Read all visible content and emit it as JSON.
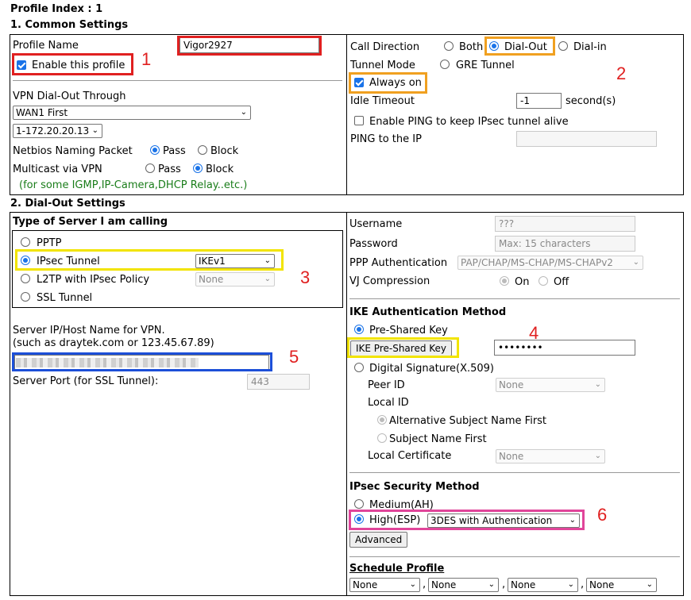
{
  "profile_index": "Profile Index : 1",
  "sections": {
    "common": "1. Common Settings",
    "dialout": "2. Dial-Out Settings"
  },
  "common": {
    "profile_name_label": "Profile Name",
    "profile_name_value": "Vigor2927",
    "enable_profile_label": "Enable this profile",
    "enable_profile_checked": true,
    "vpn_through_label": "VPN Dial-Out Through",
    "vpn_through_value": "WAN1 First",
    "ip_value": "1-172.20.20.13",
    "netbios_label": "Netbios Naming Packet",
    "netbios_pass": "Pass",
    "netbios_block": "Block",
    "multicast_label": "Multicast via VPN",
    "multicast_pass": "Pass",
    "multicast_block": "Block",
    "multicast_note": "(for some IGMP,IP-Camera,DHCP Relay..etc.)",
    "call_direction_label": "Call Direction",
    "call_both": "Both",
    "call_dialout": "Dial-Out",
    "call_dialin": "Dial-in",
    "tunnel_mode_label": "Tunnel Mode",
    "gre_tunnel": "GRE Tunnel",
    "always_on": "Always on",
    "idle_timeout_label": "Idle Timeout",
    "idle_timeout_value": "-1",
    "idle_unit": "second(s)",
    "enable_ping": "Enable PING to keep IPsec tunnel alive",
    "ping_ip_label": "PING to the IP"
  },
  "dialout": {
    "server_type_title": "Type of Server I am calling",
    "pptp": "PPTP",
    "ipsec": "IPsec Tunnel",
    "ike_version": "IKEv1",
    "l2tp": "L2TP with IPsec Policy",
    "l2tp_policy": "None",
    "ssl": "SSL Tunnel",
    "server_host_label": "Server IP/Host Name for VPN.",
    "server_host_hint": "(such as draytek.com or 123.45.67.89)",
    "server_port_label": "Server Port (for SSL Tunnel):",
    "server_port_value": "443",
    "username_label": "Username",
    "username_value": "???",
    "password_label": "Password",
    "password_placeholder": "Max: 15 characters",
    "ppp_auth_label": "PPP Authentication",
    "ppp_auth_value": "PAP/CHAP/MS-CHAP/MS-CHAPv2",
    "vj_label": "VJ Compression",
    "vj_on": "On",
    "vj_off": "Off",
    "ike_title": "IKE Authentication Method",
    "psk": "Pre-Shared Key",
    "psk_button": "IKE Pre-Shared Key",
    "psk_value": "••••••••",
    "digital_sig": "Digital Signature(X.509)",
    "peer_id_label": "Peer ID",
    "peer_id_value": "None",
    "local_id_label": "Local ID",
    "alt_subject": "Alternative Subject Name First",
    "subject_first": "Subject Name First",
    "local_cert_label": "Local Certificate",
    "local_cert_value": "None",
    "ipsec_title": "IPsec Security Method",
    "medium": "Medium(AH)",
    "high": "High(ESP)",
    "esp_value": "3DES with Authentication",
    "advanced": "Advanced",
    "schedule_title": "Schedule Profile",
    "schedules": [
      "None",
      "None",
      "None",
      "None"
    ]
  },
  "annotations": [
    "1",
    "2",
    "3",
    "4",
    "5",
    "6"
  ]
}
